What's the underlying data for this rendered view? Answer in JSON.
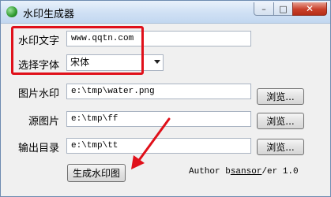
{
  "window": {
    "title": "水印生成器",
    "minimize": "–",
    "maximize": "□",
    "close": "✕"
  },
  "form": {
    "watermark_text": {
      "label": "水印文字",
      "value": "www.qqtn.com"
    },
    "font": {
      "label": "选择字体",
      "value": "宋体"
    },
    "image_watermark": {
      "label": "图片水印",
      "value": "e:\\tmp\\water.png",
      "browse": "浏览..."
    },
    "source_image": {
      "label": "源图片",
      "value": "e:\\tmp\\ff",
      "browse": "浏览..."
    },
    "output_dir": {
      "label": "输出目录",
      "value": "e:\\tmp\\tt",
      "browse": "浏览..."
    }
  },
  "generate_button": "生成水印图",
  "footer": {
    "author_prefix": "Author b",
    "author_name": "sansor",
    "author_suffix": "/er 1.0"
  },
  "colors": {
    "highlight": "#e0101a",
    "titlebar": "#cfe0f4"
  },
  "icons": [
    "app-globe-icon",
    "dropdown-caret-icon",
    "red-arrow"
  ]
}
